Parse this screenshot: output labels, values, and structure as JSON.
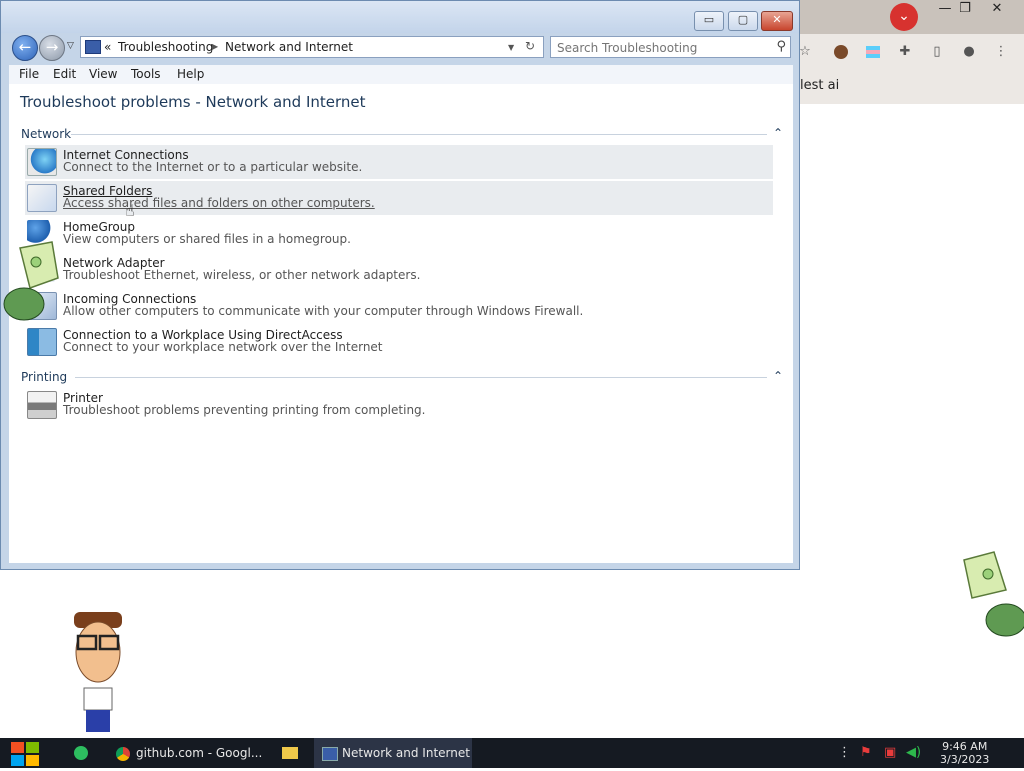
{
  "window": {
    "title_buttons": {
      "minimize": "▭",
      "maximize": "▢",
      "close": "✕"
    },
    "address": {
      "overflow": "«",
      "crumbs": [
        "Troubleshooting",
        "Network and Internet"
      ]
    },
    "search": {
      "placeholder": "Search Troubleshooting"
    },
    "menu": [
      "File",
      "Edit",
      "View",
      "Tools",
      "Help"
    ],
    "page_title": "Troubleshoot problems - Network and Internet",
    "groups": [
      {
        "label": "Network",
        "items": [
          {
            "title": "Internet Connections",
            "desc": "Connect to the Internet or to a particular website.",
            "icon": "globe-icon"
          },
          {
            "title": "Shared Folders",
            "desc": "Access shared files and folders on other computers.",
            "icon": "shared-folder-icon"
          },
          {
            "title": "HomeGroup",
            "desc": "View computers or shared files in a homegroup.",
            "icon": "homegroup-icon"
          },
          {
            "title": "Network Adapter",
            "desc": "Troubleshoot Ethernet, wireless, or other network adapters.",
            "icon": "network-adapter-icon"
          },
          {
            "title": "Incoming Connections",
            "desc": "Allow other computers to communicate with your computer through Windows Firewall.",
            "icon": "incoming-connections-icon"
          },
          {
            "title": "Connection to a Workplace Using DirectAccess",
            "desc": "Connect to your workplace network over the Internet",
            "icon": "workplace-icon"
          }
        ]
      },
      {
        "label": "Printing",
        "items": [
          {
            "title": "Printer",
            "desc": "Troubleshoot problems preventing printing from completing.",
            "icon": "printer-icon"
          }
        ]
      }
    ]
  },
  "chrome_bg": {
    "bookmark_text": "lest ai",
    "controls": {
      "minimize": "—",
      "restore": "❐",
      "close": "✕"
    }
  },
  "taskbar": {
    "tasks": [
      "github.com - Googl...",
      "Network and Internet"
    ],
    "clock_time": "9:46 AM",
    "clock_date": "3/3/2023"
  }
}
